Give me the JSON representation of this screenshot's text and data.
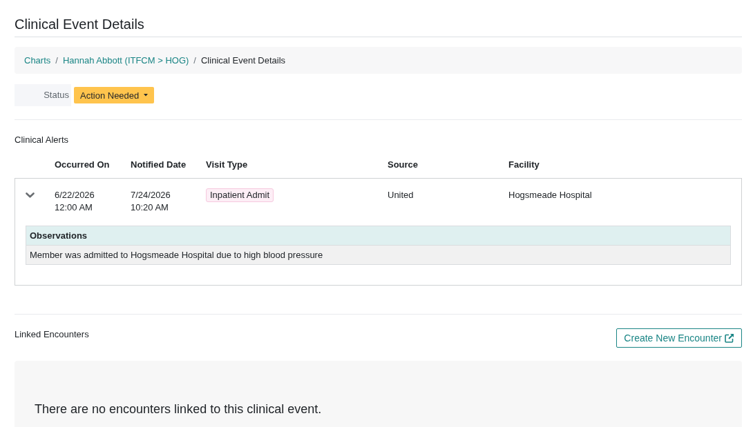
{
  "page": {
    "title": "Clinical Event Details"
  },
  "breadcrumb": {
    "separator": "/",
    "items": [
      {
        "label": "Charts",
        "kind": "link"
      },
      {
        "label": "Hannah Abbott (ITFCM > HOG)",
        "kind": "link"
      },
      {
        "label": "Clinical Event Details",
        "kind": "current"
      }
    ]
  },
  "status": {
    "label": "Status",
    "value": "Action Needed"
  },
  "clinical_alerts": {
    "title": "Clinical Alerts",
    "columns": [
      "Occurred On",
      "Notified Date",
      "Visit Type",
      "Source",
      "Facility"
    ],
    "rows": [
      {
        "expanded": true,
        "occurred_on": {
          "date": "6/22/2026",
          "time": "12:00 AM"
        },
        "notified_date": {
          "date": "7/24/2026",
          "time": "10:20 AM"
        },
        "visit_type": "Inpatient Admit",
        "source": "United",
        "facility": "Hogsmeade Hospital",
        "observations": {
          "title": "Observations",
          "text": "Member was admitted to Hogsmeade Hospital due to high blood pressure"
        }
      }
    ]
  },
  "linked_encounters": {
    "title": "Linked Encounters",
    "create_button": "Create New Encounter",
    "empty_message": "There are no encounters linked to this clinical event."
  }
}
